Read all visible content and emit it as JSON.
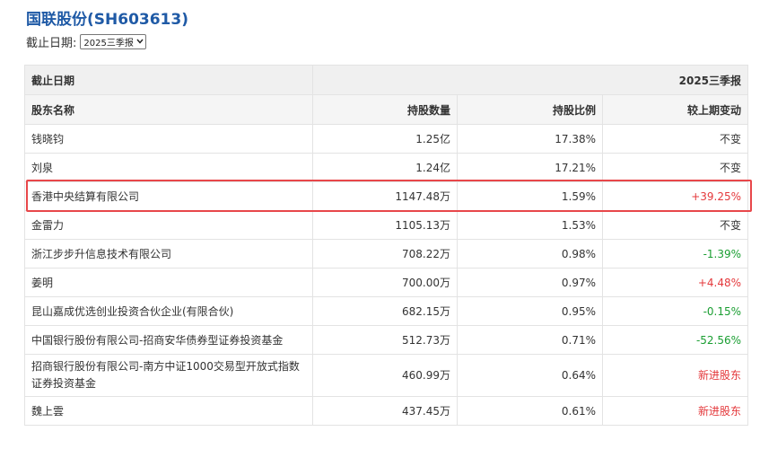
{
  "title": "国联股份(SH603613)",
  "filter": {
    "label": "截止日期:",
    "selected": "2025三季报"
  },
  "table": {
    "date_header_label": "截止日期",
    "date_header_value": "2025三季报",
    "columns": [
      "股东名称",
      "持股数量",
      "持股比例",
      "较上期变动"
    ],
    "rows": [
      {
        "name": "钱晓钧",
        "shares": "1.25亿",
        "ratio": "17.38%",
        "change": "不变",
        "trend": "flat"
      },
      {
        "name": "刘泉",
        "shares": "1.24亿",
        "ratio": "17.21%",
        "change": "不变",
        "trend": "flat"
      },
      {
        "name": "香港中央结算有限公司",
        "shares": "1147.48万",
        "ratio": "1.59%",
        "change": "+39.25%",
        "trend": "up",
        "highlighted": true
      },
      {
        "name": "金雷力",
        "shares": "1105.13万",
        "ratio": "1.53%",
        "change": "不变",
        "trend": "flat"
      },
      {
        "name": "浙江步步升信息技术有限公司",
        "shares": "708.22万",
        "ratio": "0.98%",
        "change": "-1.39%",
        "trend": "down"
      },
      {
        "name": "姜明",
        "shares": "700.00万",
        "ratio": "0.97%",
        "change": "+4.48%",
        "trend": "up"
      },
      {
        "name": "昆山嘉成优选创业投资合伙企业(有限合伙)",
        "shares": "682.15万",
        "ratio": "0.95%",
        "change": "-0.15%",
        "trend": "down"
      },
      {
        "name": "中国银行股份有限公司-招商安华债券型证券投资基金",
        "shares": "512.73万",
        "ratio": "0.71%",
        "change": "-52.56%",
        "trend": "down"
      },
      {
        "name": "招商银行股份有限公司-南方中证1000交易型开放式指数证券投资基金",
        "shares": "460.99万",
        "ratio": "0.64%",
        "change": "新进股东",
        "trend": "up",
        "tall": true
      },
      {
        "name": "魏上雲",
        "shares": "437.45万",
        "ratio": "0.61%",
        "change": "新进股东",
        "trend": "up"
      }
    ]
  },
  "colors": {
    "title": "#1f5aa6",
    "up": "#e4393c",
    "down": "#1a9e32",
    "highlight_border": "#e8474a"
  }
}
